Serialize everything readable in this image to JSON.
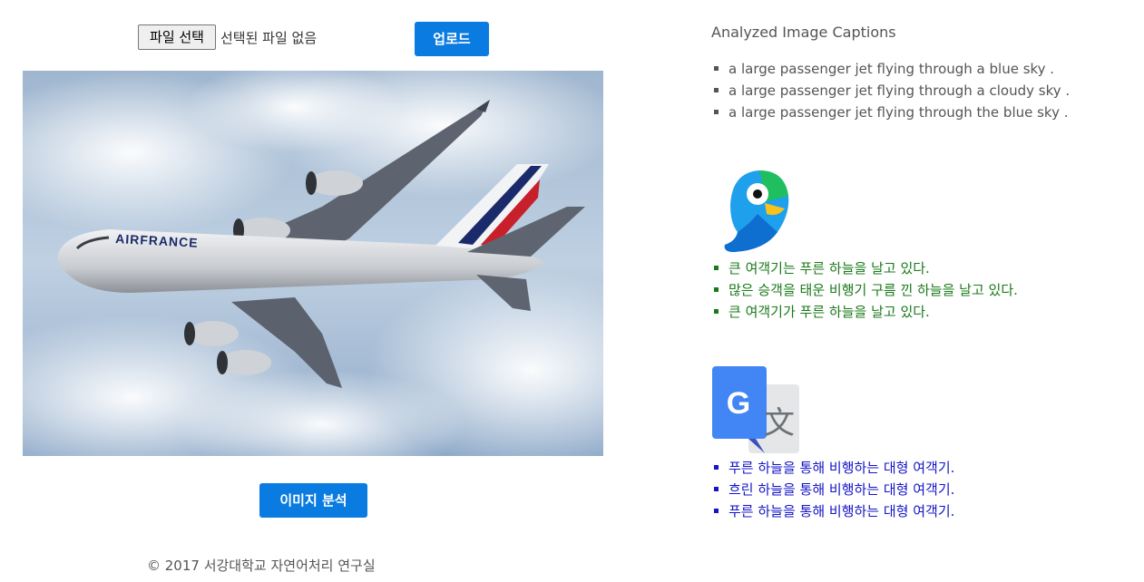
{
  "upload": {
    "file_button_label": "파일 선택",
    "file_status": "선택된 파일 없음",
    "upload_button_label": "업로드"
  },
  "image": {
    "airline_text": "AIRFRANCE"
  },
  "analyze_button_label": "이미지 분석",
  "footer": "© 2017 서강대학교 자연어처리 연구실",
  "captions": {
    "title": "Analyzed Image Captions",
    "english": [
      "a large passenger jet flying through a blue sky .",
      "a large passenger jet flying through a cloudy sky .",
      "a large passenger jet flying through the blue sky ."
    ],
    "papago": [
      "큰 여객기는 푸른 하늘을 날고 있다.",
      "많은 승객을 태운 비행기 구름 낀 하늘을 날고 있다.",
      "큰 여객기가 푸른 하늘을 날고 있다."
    ],
    "google_translate": [
      "푸른 하늘을 통해 비행하는 대형 여객기.",
      "흐린 하늘을 통해 비행하는 대형 여객기.",
      "푸른 하늘을 통해 비행하는 대형 여객기."
    ]
  },
  "icons": {
    "papago": "papago-icon",
    "google_translate": "google-translate-icon"
  },
  "colors": {
    "accent": "#0a7be0",
    "papago_text": "#1a7a1a",
    "google_text": "#1414c8",
    "muted_text": "#555555"
  }
}
